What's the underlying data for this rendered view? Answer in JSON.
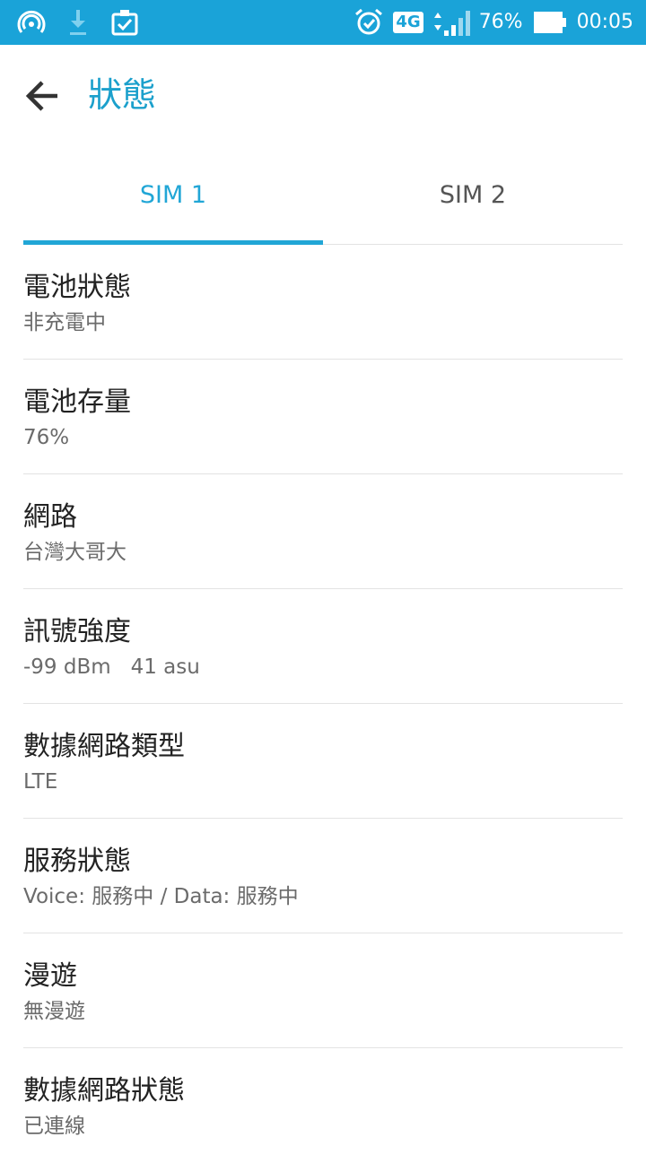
{
  "status_bar": {
    "battery_percent": "76%",
    "time": "00:05",
    "network_type": "4G",
    "icons": [
      "hotspot-icon",
      "download-icon",
      "clipboard-check-icon",
      "alarm-icon",
      "network-4g-icon",
      "signal-icon",
      "battery-icon"
    ],
    "color": "#1aa3d8"
  },
  "app_bar": {
    "title": "狀態",
    "back_icon": "arrow-back-icon",
    "title_color": "#1ba0cc"
  },
  "tabs": [
    {
      "label": "SIM 1",
      "active": true
    },
    {
      "label": "SIM 2",
      "active": false
    }
  ],
  "accent_color": "#21a6d6",
  "items": [
    {
      "title": "電池狀態",
      "value": "非充電中"
    },
    {
      "title": "電池存量",
      "value": "76%"
    },
    {
      "title": "網路",
      "value": "台灣大哥大"
    },
    {
      "title": "訊號強度",
      "value": "-99 dBm   41 asu"
    },
    {
      "title": "數據網路類型",
      "value": "LTE"
    },
    {
      "title": "服務狀態",
      "value": "Voice: 服務中 / Data: 服務中"
    },
    {
      "title": "漫遊",
      "value": "無漫遊"
    },
    {
      "title": "數據網路狀態",
      "value": "已連線"
    }
  ]
}
